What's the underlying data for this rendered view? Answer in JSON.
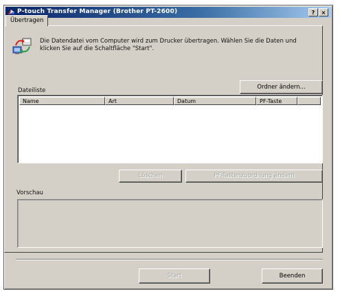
{
  "window": {
    "title": "P-touch Transfer Manager (Brother PT-2600)",
    "help_label": "?",
    "close_label": "×"
  },
  "tab": {
    "label": "Übertragen"
  },
  "info": {
    "text": "Die Datendatei vom Computer wird zum Drucker übertragen. Wählen Sie die Daten und klicken Sie auf die Schaltfläche \"Start\".",
    "icon": "transfer-icon"
  },
  "file_list": {
    "label": "Dateiliste",
    "change_folder_button": "Ordner ändern...",
    "columns": [
      "Name",
      "Art",
      "Datum",
      "PF-Taste"
    ],
    "rows": []
  },
  "list_actions": {
    "delete_button": "Löschen",
    "pf_key_button": "PF-Tastenzuordnung ändern"
  },
  "preview": {
    "label": "Vorschau"
  },
  "footer": {
    "start_button": "Start",
    "close_button": "Beenden"
  }
}
